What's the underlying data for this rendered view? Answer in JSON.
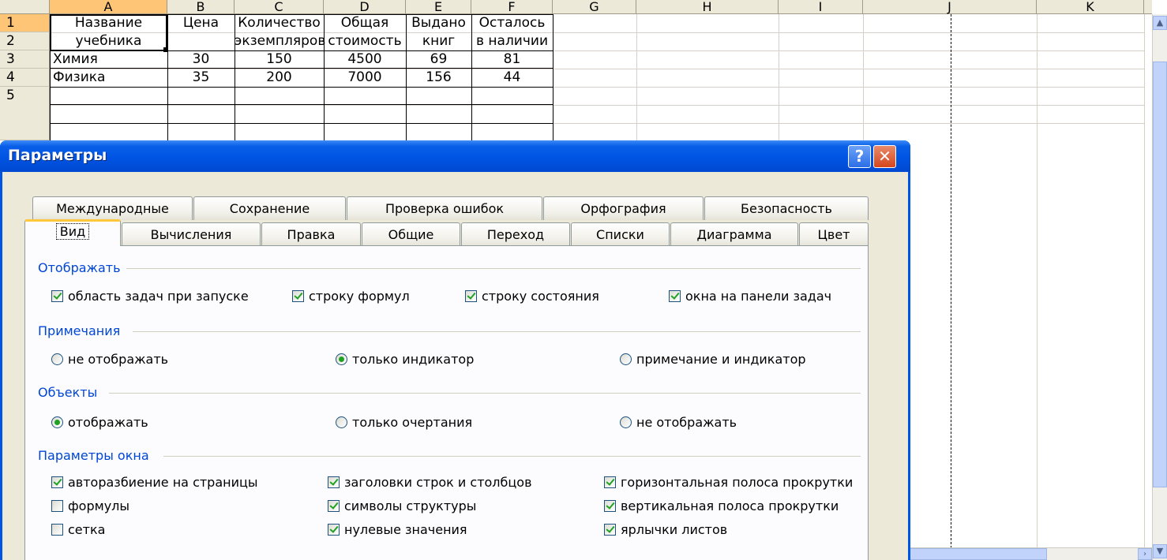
{
  "spreadsheet": {
    "columns": [
      "A",
      "B",
      "C",
      "D",
      "E",
      "F",
      "G",
      "H",
      "I",
      "J",
      "K"
    ],
    "rows": [
      "1",
      "2",
      "3",
      "4",
      "5"
    ],
    "header_row1": [
      "Название",
      "Цена",
      "Количество",
      "Общая",
      "Выдано",
      "Осталось"
    ],
    "header_row2": [
      "учебника",
      "",
      "экземпляров",
      "стоимость",
      "книг",
      "в наличии"
    ],
    "data": [
      [
        "Химия",
        "30",
        "150",
        "4500",
        "69",
        "81"
      ],
      [
        "Физика",
        "35",
        "200",
        "7000",
        "156",
        "44"
      ]
    ]
  },
  "scrollbar": {
    "up": "▲",
    "down": "▼",
    "right": "›"
  },
  "dialog": {
    "title": "Параметры",
    "help_label": "?",
    "close_label": "✕",
    "tabs_row1": [
      "Международные",
      "Сохранение",
      "Проверка ошибок",
      "Орфография",
      "Безопасность"
    ],
    "tabs_row2": [
      "Вид",
      "Вычисления",
      "Правка",
      "Общие",
      "Переход",
      "Списки",
      "Диаграмма",
      "Цвет"
    ],
    "active_tab": "Вид",
    "groups": {
      "display": {
        "label": "Отображать",
        "options": [
          {
            "label": "область задач при запуске",
            "checked": true
          },
          {
            "label": "строку формул",
            "checked": true
          },
          {
            "label": "строку состояния",
            "checked": true
          },
          {
            "label": "окна на панели задач",
            "checked": true
          }
        ]
      },
      "comments": {
        "label": "Примечания",
        "options": [
          {
            "label": "не отображать",
            "selected": false
          },
          {
            "label": "только индикатор",
            "selected": true
          },
          {
            "label": "примечание и индикатор",
            "selected": false
          }
        ]
      },
      "objects": {
        "label": "Объекты",
        "options": [
          {
            "label": "отображать",
            "selected": true
          },
          {
            "label": "только очертания",
            "selected": false
          },
          {
            "label": "не отображать",
            "selected": false
          }
        ]
      },
      "window": {
        "label": "Параметры окна",
        "options": [
          {
            "label": "авторазбиение на страницы",
            "checked": true
          },
          {
            "label": "заголовки строк и столбцов",
            "checked": true
          },
          {
            "label": "горизонтальная полоса прокрутки",
            "checked": true
          },
          {
            "label": "формулы",
            "checked": false
          },
          {
            "label": "символы структуры",
            "checked": true
          },
          {
            "label": "вертикальная полоса прокрутки",
            "checked": true
          },
          {
            "label": "сетка",
            "checked": false
          },
          {
            "label": "нулевые значения",
            "checked": true
          },
          {
            "label": "ярлычки листов",
            "checked": true
          }
        ]
      }
    }
  }
}
